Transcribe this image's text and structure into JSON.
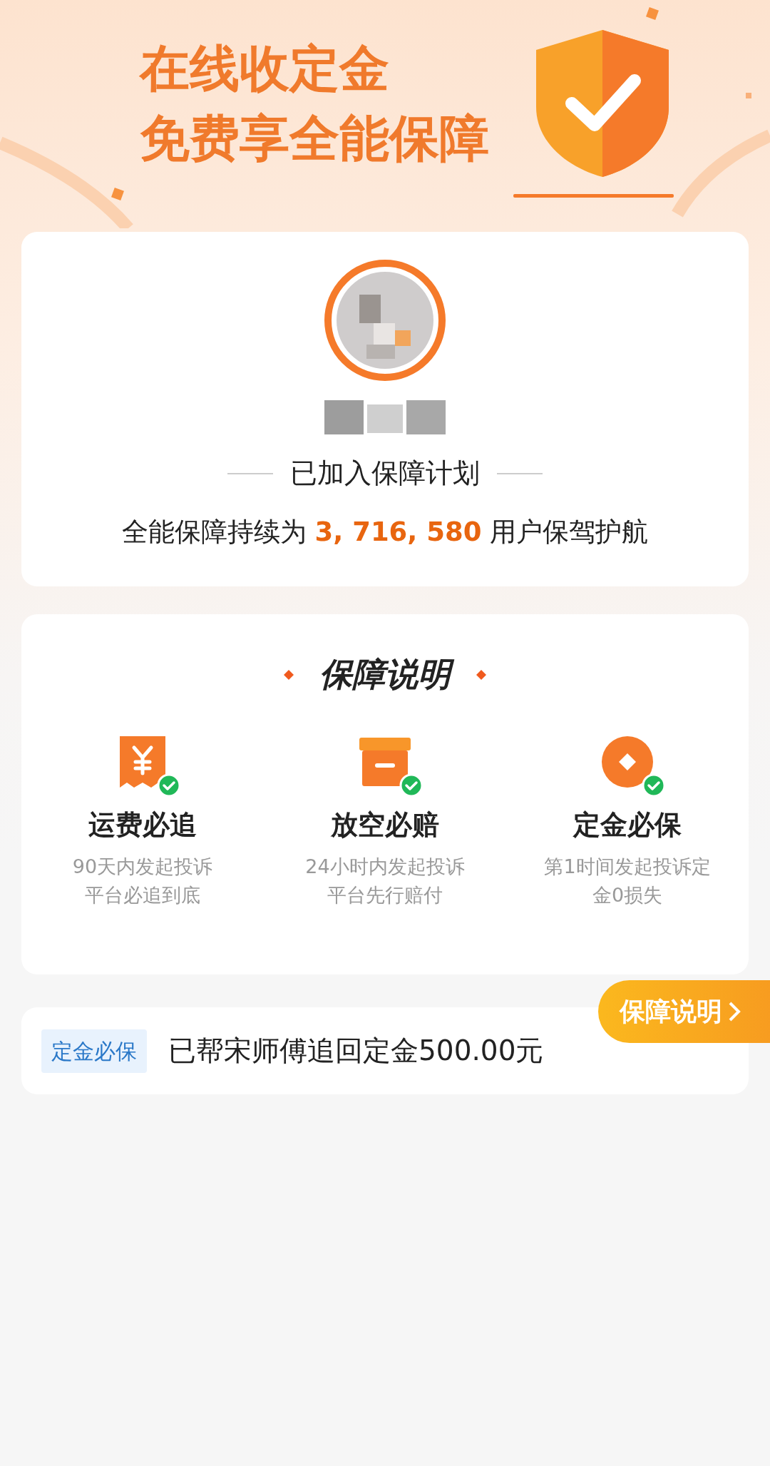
{
  "banner": {
    "title_lines": [
      "在线收定金",
      "免费享全能保障"
    ]
  },
  "profile": {
    "status": "已加入保障计划",
    "stats": "全能保障持续为 **3, 716, 580** 用户保驾护航"
  },
  "guarantee": {
    "title": "保障说明",
    "items": [
      {
        "kind": "receipt",
        "title": "运费必追",
        "desc_lines": [
          "90天内发起投诉",
          "平台必追到底"
        ]
      },
      {
        "kind": "box",
        "title": "放空必赔",
        "desc_lines": [
          "24小时内发起投诉",
          "平台先行赔付"
        ]
      },
      {
        "kind": "coin",
        "title": "定金必保",
        "desc_lines": [
          "第1时间发起投诉定",
          "金0损失"
        ]
      }
    ]
  },
  "record": {
    "tag": "定金必保",
    "text": "已帮宋师傅追回定金500.00元"
  },
  "float_button": {
    "label": "保障说明"
  }
}
